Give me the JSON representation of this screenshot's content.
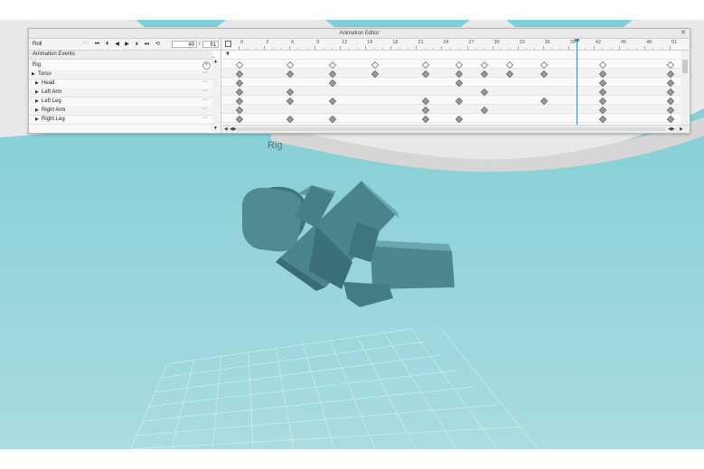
{
  "editor": {
    "title": "Animation Editor",
    "close_icon": "close-icon",
    "animation_name": "Roll",
    "current_frame": "40",
    "frame_separator": "/",
    "end_frame": "51",
    "events_label": "Animation Events",
    "tracks": [
      {
        "label": "Rig",
        "level": 0,
        "arrow": "",
        "action": "+"
      },
      {
        "label": "Torso",
        "level": 0,
        "arrow": "▶",
        "action": "⋯"
      },
      {
        "label": "Head",
        "level": 1,
        "arrow": "▶",
        "action": "⋯"
      },
      {
        "label": "Left Arm",
        "level": 1,
        "arrow": "▶",
        "action": "⋯"
      },
      {
        "label": "Left Leg",
        "level": 1,
        "arrow": "▶",
        "action": "⋯"
      },
      {
        "label": "Right Arm",
        "level": 1,
        "arrow": "▶",
        "action": "⋯"
      },
      {
        "label": "Right Leg",
        "level": 1,
        "arrow": "▶",
        "action": "⋯"
      }
    ],
    "ruler_labels": [
      "0",
      "3",
      "6",
      "9",
      "12",
      "15",
      "18",
      "21",
      "24",
      "27",
      "30",
      "33",
      "36",
      "39",
      "42",
      "45",
      "48",
      "51"
    ],
    "playhead_frame": 40,
    "keyframes": [
      [
        0,
        6,
        11,
        16,
        22,
        26,
        29,
        32,
        36,
        43,
        51
      ],
      [
        0,
        6,
        11,
        16,
        22,
        26,
        29,
        32,
        36,
        43,
        51
      ],
      [
        0,
        11,
        26,
        43,
        51
      ],
      [
        0,
        6,
        29,
        43,
        51
      ],
      [
        0,
        6,
        11,
        22,
        26,
        36,
        43,
        51
      ],
      [
        0,
        22,
        29,
        43,
        51
      ],
      [
        0,
        6,
        11,
        22,
        26,
        43,
        51
      ]
    ]
  },
  "viewport": {
    "rig_label": "Rig",
    "sky_color": "#7fcfd6",
    "floor_color": "#a6d8dc",
    "model_color": "#4f8b91"
  }
}
